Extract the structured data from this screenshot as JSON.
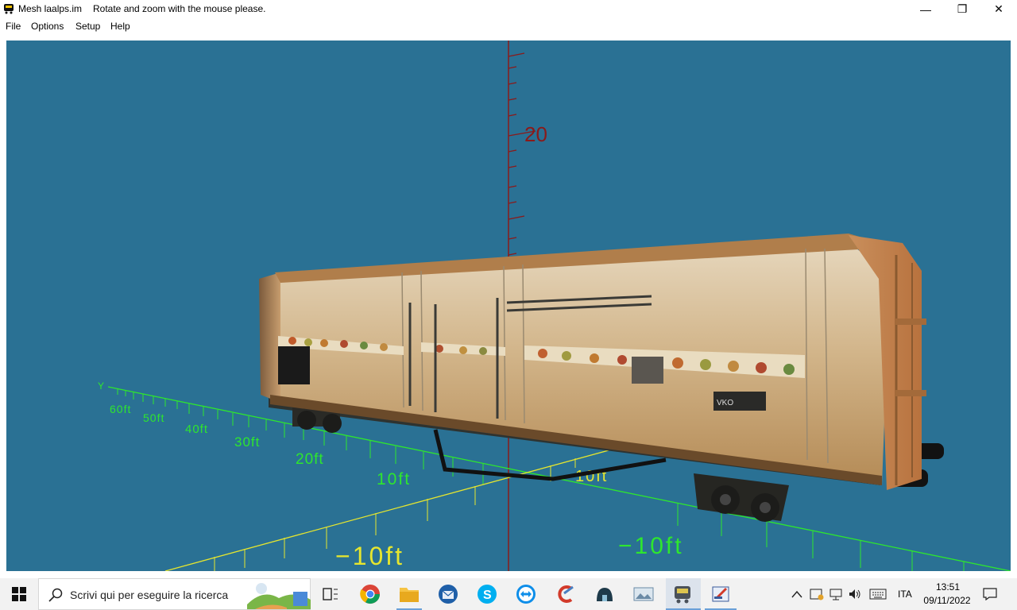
{
  "window": {
    "title": "Mesh laalps.im",
    "hint": "Rotate and zoom with the mouse please.",
    "controls": {
      "minimize": "—",
      "restore": "❐",
      "close": "✕"
    }
  },
  "menu": {
    "items": [
      "File",
      "Options",
      "Setup",
      "Help"
    ]
  },
  "viewport": {
    "background": "#2a7194",
    "axis_labels": {
      "vertical_tick": "20",
      "y_axis_letter": "Y",
      "y_ticks": [
        "60ft",
        "50ft",
        "40ft",
        "30ft",
        "20ft",
        "10ft"
      ],
      "x_neg_left": "−10ft",
      "x_neg_right": "−10ft",
      "x_pos_partial": "10ft"
    },
    "colors": {
      "green_axis": "#2ee62e",
      "yellow_axis": "#e6e62e",
      "red_axis": "#8a1a1a"
    },
    "model": {
      "name": "laalps",
      "car_number": "VKO"
    }
  },
  "taskbar": {
    "search_placeholder": "Scrivi qui per eseguire la ricerca",
    "apps": [
      "task-view-icon",
      "chrome-icon",
      "file-explorer-icon",
      "thunderbird-icon",
      "skype-icon",
      "teamviewer-icon",
      "ccleaner-icon",
      "app-icon-dome",
      "photos-icon",
      "mesh-viewer-icon",
      "editor-icon"
    ],
    "tray": {
      "language": "ITA",
      "time": "13:51",
      "date": "09/11/2022"
    }
  }
}
